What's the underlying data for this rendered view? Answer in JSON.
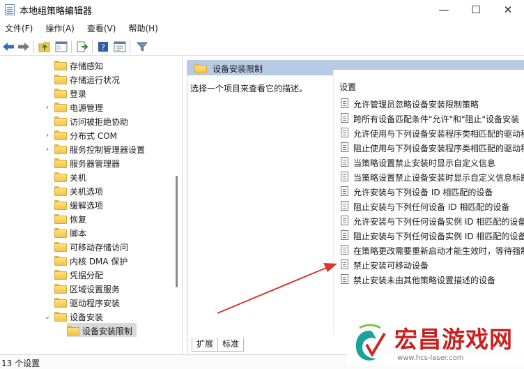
{
  "window": {
    "title": "本地组策略编辑器",
    "min_glyph": "—",
    "max_glyph": "☐",
    "close_glyph": "✕"
  },
  "menu": [
    "文件(F)",
    "操作(A)",
    "查看(V)",
    "帮助(H)"
  ],
  "toolbar": {
    "icons": [
      "back-icon",
      "forward-icon",
      "up-folder-icon",
      "show-hide-tree-icon",
      "export-list-icon",
      "help-icon",
      "properties-icon",
      "filter-icon"
    ]
  },
  "tree": {
    "items": [
      {
        "label": "存储感知",
        "expandable": false
      },
      {
        "label": "存储运行状况",
        "expandable": false
      },
      {
        "label": "登录",
        "expandable": false
      },
      {
        "label": "电源管理",
        "expandable": true
      },
      {
        "label": "访问被拒绝协助",
        "expandable": false
      },
      {
        "label": "分布式 COM",
        "expandable": true
      },
      {
        "label": "服务控制管理器设置",
        "expandable": true
      },
      {
        "label": "服务器管理器",
        "expandable": false
      },
      {
        "label": "关机",
        "expandable": false
      },
      {
        "label": "关机选项",
        "expandable": false
      },
      {
        "label": "缓解选项",
        "expandable": false
      },
      {
        "label": "恢复",
        "expandable": false
      },
      {
        "label": "脚本",
        "expandable": false
      },
      {
        "label": "可移动存储访问",
        "expandable": false
      },
      {
        "label": "内核 DMA 保护",
        "expandable": false
      },
      {
        "label": "凭据分配",
        "expandable": false
      },
      {
        "label": "区域设置服务",
        "expandable": false
      },
      {
        "label": "驱动程序安装",
        "expandable": false
      },
      {
        "label": "设备安装",
        "expandable": true,
        "expanded": true
      },
      {
        "label": "设备安装限制",
        "child": true,
        "selected": true
      }
    ]
  },
  "right": {
    "header_title": "设备安装限制",
    "description": "选择一个项目来查看它的描述。",
    "column_header": "设置",
    "settings": [
      "允许管理员忽略设备安装限制策略",
      "跨所有设备匹配条件\"允许\"和\"阻止\"设备安装",
      "允许使用与下列设备安装程序类相匹配的驱动程",
      "阻止使用与下列设备安装程序类相匹配的驱动程",
      "当策略设置禁止安装时显示自定义信息",
      "当策略设置禁止设备安装时显示自定义信息标题",
      "允许安装与下列设备 ID 相匹配的设备",
      "阻止安装与下列任何设备 ID 相匹配的设备",
      "允许安装与下列任何设备实例 ID 相匹配的设备",
      "阻止安装与下列任何设备实例 ID 相匹配的设备",
      "在策略更改需要重新启动才能生效时，等待强制",
      "禁止安装可移动设备",
      "禁止安装未由其他策略设置描述的设备"
    ],
    "tabs": [
      "扩展",
      "标准"
    ]
  },
  "status": {
    "text": "13 个设置"
  },
  "watermark": {
    "text": "宏昌游戏网",
    "url": "www.hcs-laser.com"
  },
  "colors": {
    "header_bg": "#b7cbe6",
    "arrow": "#d8382c",
    "watermark": "#cc1f1f"
  }
}
